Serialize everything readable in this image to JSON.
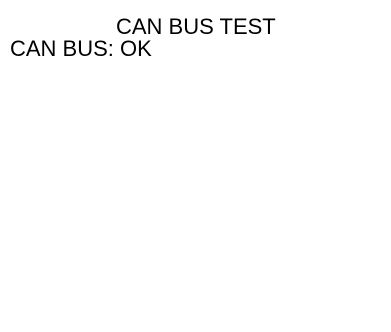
{
  "screen": {
    "title": "CAN BUS TEST",
    "status_line": "CAN BUS: OK"
  },
  "colors": {
    "background": "#ffffff",
    "text": "#000000"
  }
}
